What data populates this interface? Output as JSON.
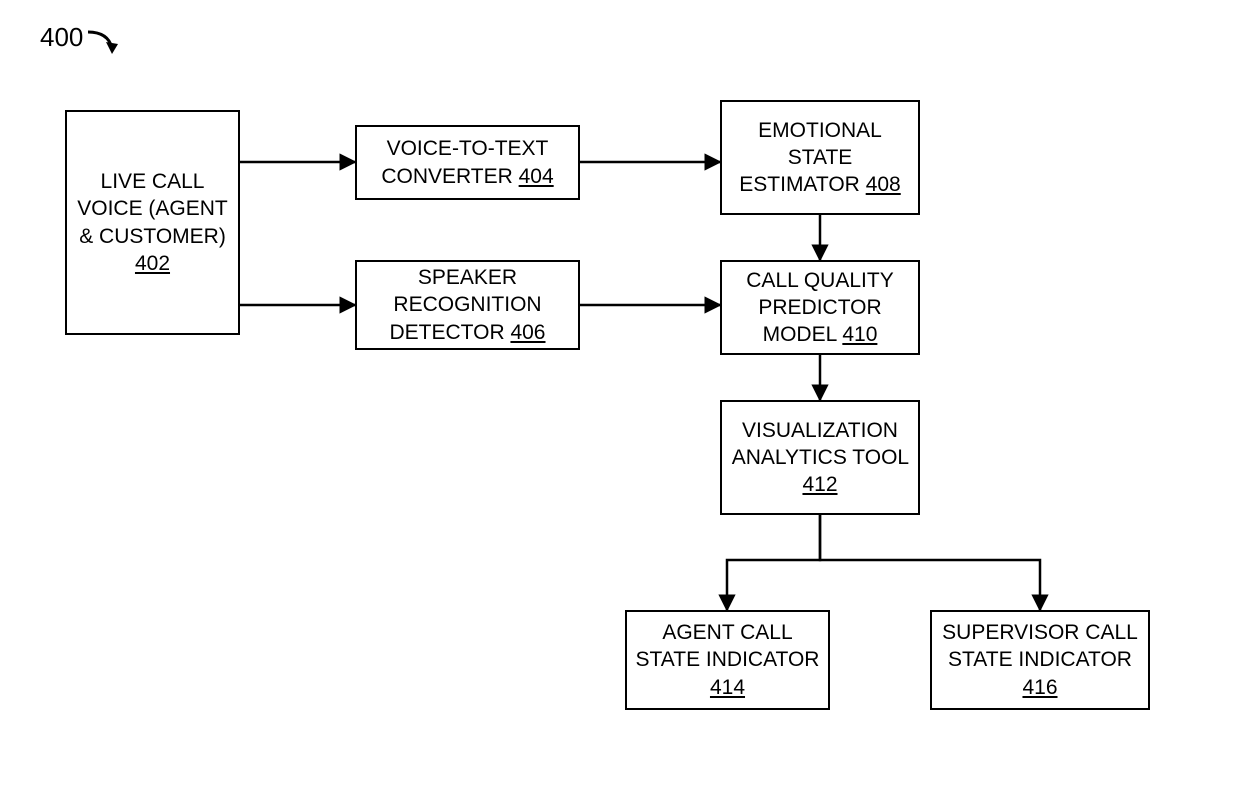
{
  "figure": {
    "number_label": "400",
    "blocks": {
      "live_call": {
        "text": "LIVE CALL VOICE (AGENT & CUSTOMER)",
        "ref": "402"
      },
      "vtt": {
        "text": "VOICE-TO-TEXT CONVERTER",
        "ref": "404"
      },
      "speaker": {
        "text": "SPEAKER RECOGNITION DETECTOR",
        "ref": "406"
      },
      "emotional": {
        "text": "EMOTIONAL STATE ESTIMATOR",
        "ref": "408"
      },
      "predictor": {
        "text": "CALL QUALITY PREDICTOR MODEL",
        "ref": "410"
      },
      "viz": {
        "text": "VISUALIZATION ANALYTICS TOOL",
        "ref": "412"
      },
      "agent_ind": {
        "text": "AGENT CALL STATE INDICATOR",
        "ref": "414"
      },
      "sup_ind": {
        "text": "SUPERVISOR CALL STATE INDICATOR",
        "ref": "416"
      }
    }
  }
}
